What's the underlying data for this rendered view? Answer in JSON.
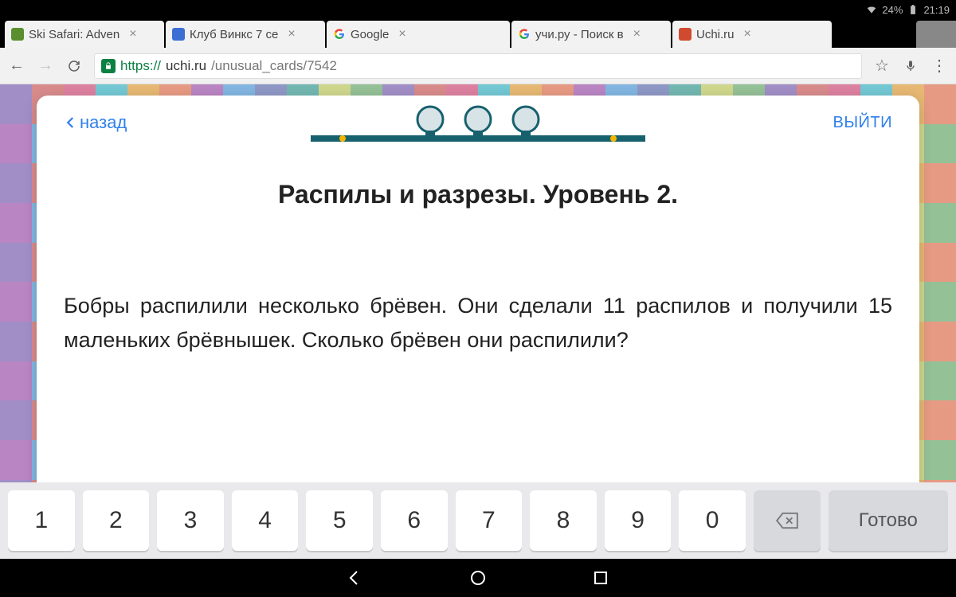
{
  "status": {
    "battery": "24%",
    "time": "21:19"
  },
  "tabs": [
    {
      "title": "Ski Safari: Adven",
      "fav": "#5a8f2e"
    },
    {
      "title": "Клуб Винкс 7 се",
      "fav": "#3b6fd4"
    },
    {
      "title": "Google",
      "fav": "google"
    },
    {
      "title": "учи.ру - Поиск в",
      "fav": "google"
    },
    {
      "title": "Uchi.ru",
      "fav": "#d04a2f"
    }
  ],
  "url": {
    "scheme": "https",
    "host": "uchi.ru",
    "path": "/unusual_cards/7542"
  },
  "card": {
    "back": "назад",
    "exit": "ВЫЙТИ",
    "title": "Распилы и разрезы. Уровень 2.",
    "problem": "Бобры распилили несколько брёвен. Они сделали 11 распилов и получили 15 маленьких брёвнышек. Сколько брёвен они распилили?"
  },
  "keyboard": {
    "keys": [
      "1",
      "2",
      "3",
      "4",
      "5",
      "6",
      "7",
      "8",
      "9",
      "0"
    ],
    "done": "Готово"
  },
  "bg_colors": [
    "#b39ddb",
    "#90caf9",
    "#f48fb1",
    "#80cbc4",
    "#ffcc80",
    "#a5d6a7",
    "#ce93d8",
    "#ef9a9a",
    "#9fa8da",
    "#80deea",
    "#e6ee9c",
    "#ffab91"
  ]
}
